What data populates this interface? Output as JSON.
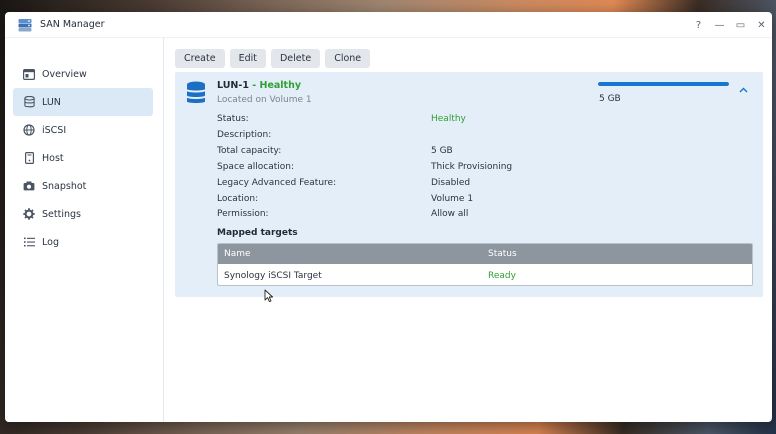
{
  "window": {
    "title": "SAN Manager",
    "controls": [
      "?",
      "—",
      "▭",
      "✕"
    ]
  },
  "sidebar": {
    "items": [
      {
        "label": "Overview",
        "icon": "overview-icon",
        "active": false
      },
      {
        "label": "LUN",
        "icon": "database-icon",
        "active": true
      },
      {
        "label": "iSCSI",
        "icon": "globe-icon",
        "active": false
      },
      {
        "label": "Host",
        "icon": "server-icon",
        "active": false
      },
      {
        "label": "Snapshot",
        "icon": "camera-icon",
        "active": false
      },
      {
        "label": "Settings",
        "icon": "gear-icon",
        "active": false
      },
      {
        "label": "Log",
        "icon": "list-icon",
        "active": false
      }
    ]
  },
  "toolbar": {
    "create": "Create",
    "edit": "Edit",
    "delete": "Delete",
    "clone": "Clone"
  },
  "lun": {
    "name": "LUN-1",
    "separator": " - ",
    "health": "Healthy",
    "location_line": "Located on Volume 1",
    "capacity": "5 GB",
    "usage_fraction": 1.0,
    "details": [
      {
        "label": "Status:",
        "value": "Healthy",
        "green": true
      },
      {
        "label": "Description:",
        "value": "",
        "green": false
      },
      {
        "label": "Total capacity:",
        "value": "5 GB",
        "green": false
      },
      {
        "label": "Space allocation:",
        "value": "Thick Provisioning",
        "green": false
      },
      {
        "label": "Legacy Advanced Feature:",
        "value": "Disabled",
        "green": false
      },
      {
        "label": "Location:",
        "value": "Volume 1",
        "green": false
      },
      {
        "label": "Permission:",
        "value": "Allow all",
        "green": false
      }
    ]
  },
  "mapped_targets": {
    "title": "Mapped targets",
    "columns": [
      "Name",
      "Status"
    ],
    "rows": [
      {
        "name": "Synology iSCSI Target",
        "status": "Ready"
      }
    ]
  },
  "colors": {
    "accent": "#1677d3",
    "healthy": "#32a032",
    "panel": "#e3eef9",
    "active_nav": "#dbe9f7"
  }
}
